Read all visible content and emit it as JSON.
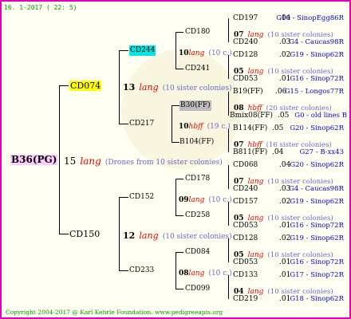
{
  "header": "16. 1-2017 ( 22: 5)",
  "footer": "Copyright 2004-2017 @ Karl Kehrle Foundation.   www.pedigreeapis.org",
  "root": {
    "id": "B36(PG)",
    "gen_num": "15",
    "gen_word": "lang",
    "gen_note": "(Drones from 10 sister colonies)"
  },
  "sire": {
    "id": "CD074",
    "gen_num": "13",
    "gen_word": "lang",
    "gen_note": "(10 sister colonies)"
  },
  "dam": {
    "id": "CD150",
    "gen_num": "12",
    "gen_word": "lang",
    "gen_note": "(10 sister colonies)"
  },
  "nodes": {
    "cd244": {
      "id": "CD244",
      "gen_num": "10",
      "gen_word": "lang",
      "gen_note": "(10 c.)"
    },
    "cd217": {
      "id": "CD217",
      "gen_num": "10",
      "gen_word": "hbff",
      "gen_note": "(19 c.)"
    },
    "cd152": {
      "id": "CD152",
      "gen_num": "09",
      "gen_word": "lang",
      "gen_note": "(10 c.)"
    },
    "cd233": {
      "id": "CD233",
      "gen_num": "08",
      "gen_word": "lang",
      "gen_note": "(10 c.)"
    },
    "cd180": {
      "id": "CD180",
      "gen_num": "07",
      "gen_word": "lang",
      "gen_note": "(10 sister colonies)"
    },
    "cd241": {
      "id": "CD241",
      "gen_num": "05",
      "gen_word": "lang",
      "gen_note": "(10 sister colonies)"
    },
    "b30": {
      "id": "B30(FF)",
      "gen_num": "08",
      "gen_word": "hbff",
      "gen_note": "(20 sister colonies)"
    },
    "b104": {
      "id": "B104(FF)",
      "gen_num": "07",
      "gen_word": "hbff",
      "gen_note": "(16 sister colonies)"
    },
    "cd178": {
      "id": "CD178",
      "gen_num": "07",
      "gen_word": "lang",
      "gen_note": "(10 sister colonies)"
    },
    "cd258": {
      "id": "CD258",
      "gen_num": "05",
      "gen_word": "lang",
      "gen_note": "(10 sister colonies)"
    },
    "cd084": {
      "id": "CD084",
      "gen_num": "05",
      "gen_word": "lang",
      "gen_note": "(10 sister colonies)"
    },
    "cd099": {
      "id": "CD099",
      "gen_num": "04",
      "gen_word": "lang",
      "gen_note": "(10 sister colonies)"
    }
  },
  "leaves": [
    {
      "id": "CD197",
      "score": ".04",
      "ref": "G10 - SinopEgg86R"
    },
    {
      "id": "CD240",
      "score": ".03",
      "ref": "G4 - Caucas98R"
    },
    {
      "id": "CD128",
      "score": ".02",
      "ref": "G19 - Sinop62R"
    },
    {
      "id": "CD053",
      "score": ".01",
      "ref": "G16 - Sinop72R"
    },
    {
      "id": "B19(FF)",
      "score": ".06",
      "ref": "G15 - Longos77R"
    },
    {
      "id": "Bmix08(FF)",
      "score": ".05",
      "ref": "G0 - old lines B"
    },
    {
      "id": "B114(FF)",
      "score": ".05",
      "ref": "G20 - Sinop62R"
    },
    {
      "id": "B811(FF)",
      "score": ".04",
      "ref": "G27 - B-xx43"
    },
    {
      "id": "CD068",
      "score": ".04",
      "ref": "G20 - Sinop62R"
    },
    {
      "id": "CD240",
      "score": ".03",
      "ref": "G4 - Caucas98R"
    },
    {
      "id": "CD157",
      "score": ".02",
      "ref": "G19 - Sinop62R"
    },
    {
      "id": "CD053",
      "score": ".01",
      "ref": "G16 - Sinop72R"
    },
    {
      "id": "CD128",
      "score": ".02",
      "ref": "G19 - Sinop62R"
    },
    {
      "id": "CD053",
      "score": ".01",
      "ref": "G16 - Sinop72R"
    },
    {
      "id": "CD133",
      "score": ".01",
      "ref": "G17 - Sinop72R"
    },
    {
      "id": "CD219",
      "score": ".01",
      "ref": "G18 - Sinop62R"
    }
  ],
  "colors": {
    "border": "#e600b4",
    "background": "#fffff2",
    "lang": "#ee0000",
    "ref": "#0000cc",
    "note": "#6666cc",
    "root_highlight": "#ffccff",
    "sire_highlight": "#ffff00",
    "cd244_highlight": "#00e5e5",
    "b30_highlight": "#bbbbbb",
    "footer": "#009900"
  }
}
